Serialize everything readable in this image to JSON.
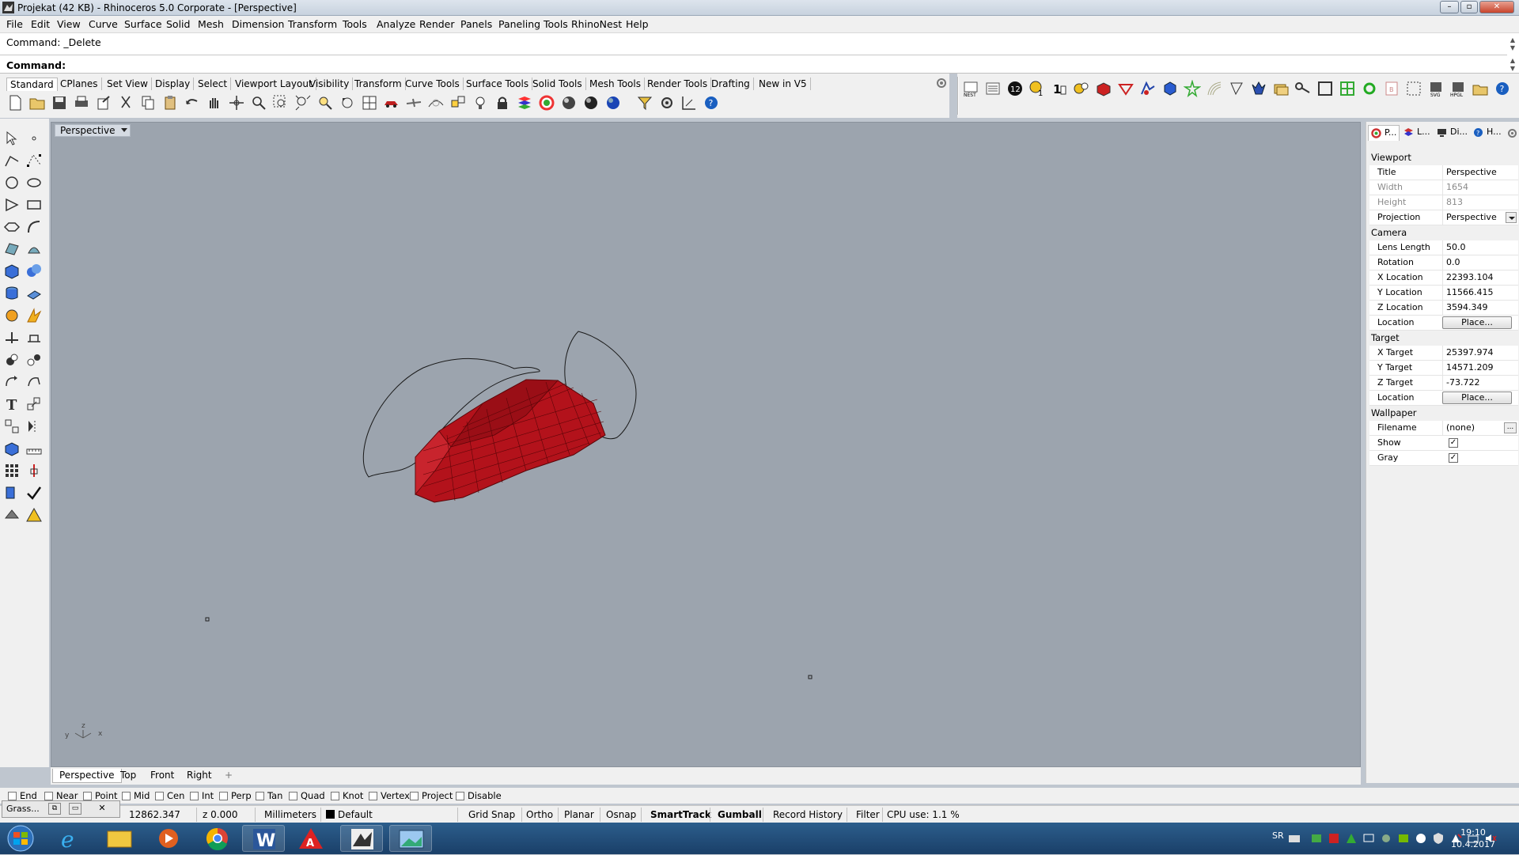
{
  "window": {
    "title": "Projekat (42 KB) - Rhinoceros  5.0 Corporate - [Perspective]"
  },
  "menu": [
    "File",
    "Edit",
    "View",
    "Curve",
    "Surface",
    "Solid",
    "Mesh",
    "Dimension",
    "Transform",
    "Tools",
    "Analyze",
    "Render",
    "Panels",
    "Paneling Tools",
    "RhinoNest",
    "Help"
  ],
  "command": {
    "history": "Command: _Delete",
    "label": "Command:"
  },
  "toolbar_tabs": [
    "Standard",
    "CPlanes",
    "Set View",
    "Display",
    "Select",
    "Viewport Layout",
    "Visibility",
    "Transform",
    "Curve Tools",
    "Surface Tools",
    "Solid Tools",
    "Mesh Tools",
    "Render Tools",
    "Drafting",
    "New in V5"
  ],
  "viewport": {
    "title": "Perspective",
    "axes": {
      "z": "z",
      "y": "y",
      "x": "x"
    }
  },
  "viewport_tabs": [
    "Perspective",
    "Top",
    "Front",
    "Right"
  ],
  "osnaps": [
    {
      "label": "End",
      "checked": false
    },
    {
      "label": "Near",
      "checked": false
    },
    {
      "label": "Point",
      "checked": false
    },
    {
      "label": "Mid",
      "checked": false
    },
    {
      "label": "Cen",
      "checked": false
    },
    {
      "label": "Int",
      "checked": false
    },
    {
      "label": "Perp",
      "checked": false
    },
    {
      "label": "Tan",
      "checked": false
    },
    {
      "label": "Quad",
      "checked": false
    },
    {
      "label": "Knot",
      "checked": false
    },
    {
      "label": "Vertex",
      "checked": false
    },
    {
      "label": "Project",
      "checked": false
    },
    {
      "label": "Disable",
      "checked": false
    }
  ],
  "minipanel": {
    "label": "Grass..."
  },
  "status": {
    "y": "12862.347",
    "z": "z 0.000",
    "units": "Millimeters",
    "layer": "Default",
    "grid_snap": "Grid Snap",
    "ortho": "Ortho",
    "planar": "Planar",
    "osnap": "Osnap",
    "smarttrack": "SmartTrack",
    "gumball": "Gumball",
    "record_history": "Record History",
    "filter": "Filter",
    "cpu": "CPU use: 1.1 %"
  },
  "panel_tabs": [
    "P...",
    "L...",
    "Di...",
    "H..."
  ],
  "properties": {
    "viewport_section": "Viewport",
    "title_k": "Title",
    "title_v": "Perspective",
    "width_k": "Width",
    "width_v": "1654",
    "height_k": "Height",
    "height_v": "813",
    "projection_k": "Projection",
    "projection_v": "Perspective",
    "camera_section": "Camera",
    "lens_k": "Lens Length",
    "lens_v": "50.0",
    "rotation_k": "Rotation",
    "rotation_v": "0.0",
    "xloc_k": "X Location",
    "xloc_v": "22393.104",
    "yloc_k": "Y Location",
    "yloc_v": "11566.415",
    "zloc_k": "Z Location",
    "zloc_v": "3594.349",
    "loc_k": "Location",
    "place": "Place...",
    "target_section": "Target",
    "xt_k": "X Target",
    "xt_v": "25397.974",
    "yt_k": "Y Target",
    "yt_v": "14571.209",
    "zt_k": "Z Target",
    "zt_v": "-73.722",
    "tloc_k": "Location",
    "wallpaper_section": "Wallpaper",
    "file_k": "Filename",
    "file_v": "(none)",
    "show_k": "Show",
    "show_v": true,
    "gray_k": "Gray",
    "gray_v": true
  },
  "taskbar": {
    "language": "SR",
    "time": "19:10",
    "date": "10.4.2017"
  },
  "colors": {
    "mesh": "#b3121b",
    "viewport_bg": "#9ca4ae",
    "taskbar": "#1f4a78"
  }
}
